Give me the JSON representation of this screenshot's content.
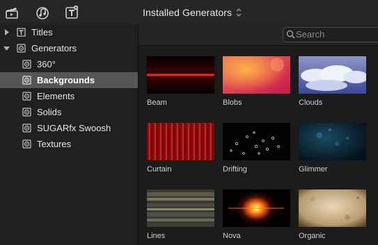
{
  "toolbar": {
    "icons": [
      "clapper-board-icon",
      "music-notes-icon",
      "title-text-icon"
    ],
    "title": "Installed Generators"
  },
  "sidebar": {
    "items": [
      {
        "label": "Titles",
        "icon": "titles-icon",
        "disclosure": "collapsed",
        "selected": false
      },
      {
        "label": "Generators",
        "icon": "generators-icon",
        "disclosure": "expanded",
        "selected": false
      },
      {
        "label": "360°",
        "icon": "generator-category-icon",
        "selected": false
      },
      {
        "label": "Backgrounds",
        "icon": "generator-category-icon",
        "selected": true
      },
      {
        "label": "Elements",
        "icon": "generator-category-icon",
        "selected": false
      },
      {
        "label": "Solids",
        "icon": "generator-category-icon",
        "selected": false
      },
      {
        "label": "SUGARfx Swoosh",
        "icon": "generator-category-icon",
        "selected": false
      },
      {
        "label": "Textures",
        "icon": "generator-category-icon",
        "selected": false
      }
    ]
  },
  "search": {
    "placeholder": "Search",
    "value": ""
  },
  "generators": [
    {
      "name": "Beam"
    },
    {
      "name": "Blobs"
    },
    {
      "name": "Clouds"
    },
    {
      "name": "Curtain"
    },
    {
      "name": "Drifting"
    },
    {
      "name": "Glimmer"
    },
    {
      "name": "Lines"
    },
    {
      "name": "Nova"
    },
    {
      "name": "Organic"
    }
  ],
  "colors": {
    "selection": "#565656",
    "background": "#1b1b1b",
    "sidebar": "#202020"
  }
}
